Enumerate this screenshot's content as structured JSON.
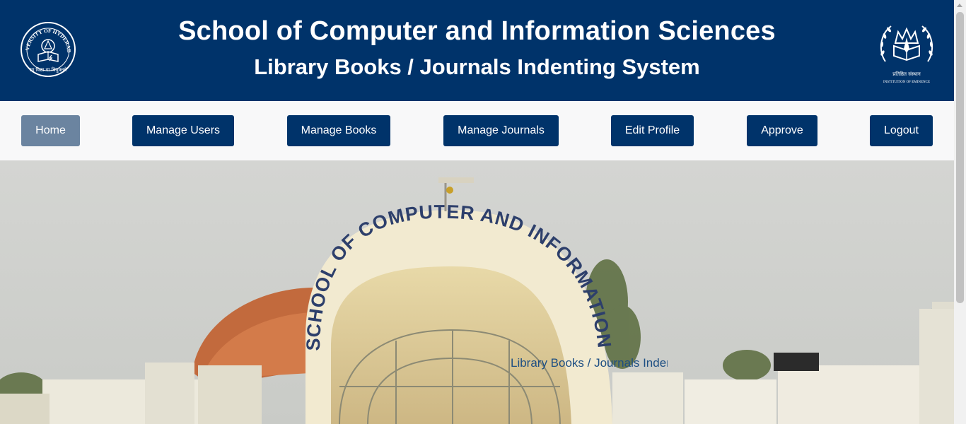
{
  "header": {
    "title": "School of Computer and Information Sciences",
    "subtitle": "Library Books / Journals Indenting System",
    "left_logo_icon": "university-of-hyderabad-seal",
    "right_logo_icon": "institution-of-eminence-emblem",
    "right_logo_caption_hindi": "प्रतिष्ठित संस्थान",
    "right_logo_caption": "INSTITUTION OF EMINENCE",
    "left_logo_text": "UNIVERSITY OF HYDERABAD",
    "left_logo_motto": "सा विद्या या विमुक्तये"
  },
  "nav": {
    "items": [
      {
        "label": "Home",
        "active": true
      },
      {
        "label": "Manage Users",
        "active": false
      },
      {
        "label": "Manage Books",
        "active": false
      },
      {
        "label": "Manage Journals",
        "active": false
      },
      {
        "label": "Edit Profile",
        "active": false
      },
      {
        "label": "Approve",
        "active": false
      },
      {
        "label": "Logout",
        "active": false
      }
    ]
  },
  "hero": {
    "image_alt": "School of Computer and Information Sciences building",
    "arch_sign_text": "SCHOOL OF COMPUTER AND INFORMATION SCIENCES",
    "caption": "Library Books / Journals Indenting System"
  },
  "colors": {
    "brand_navy": "#00336a",
    "active_button": "#6b84a0",
    "navbar_bg": "#f8f8f9"
  }
}
